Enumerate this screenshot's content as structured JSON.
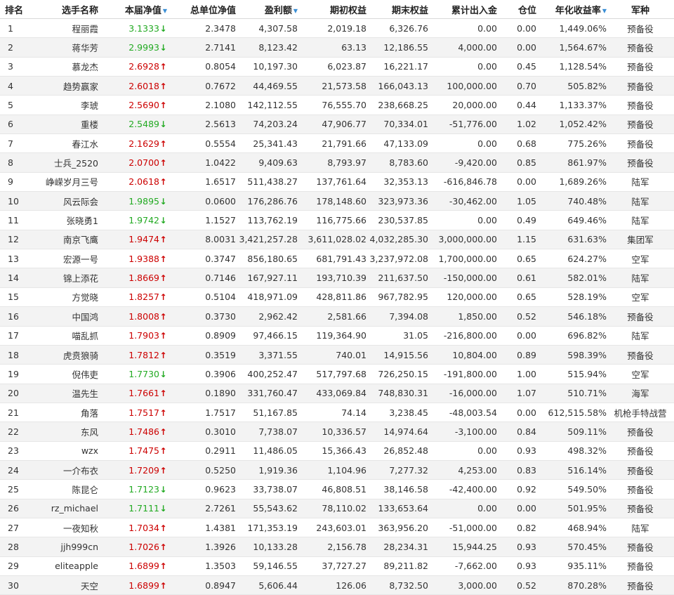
{
  "headers": {
    "rank": "排名",
    "name": "选手名称",
    "nav": "本届净值",
    "total_nav": "总单位净值",
    "profit": "盈利额",
    "start_equity": "期初权益",
    "end_equity": "期末权益",
    "net_deposit": "累计出入金",
    "position": "仓位",
    "annual_return": "年化收益率",
    "group": "军种"
  },
  "colors": {
    "up": "#cc0000",
    "down": "#22aa22",
    "sort_icon": "#3a8fd6",
    "zebra": "#f3f3f3"
  },
  "icons": {
    "sort": "sort-down-icon",
    "up": "arrow-up-icon",
    "down": "arrow-down-icon"
  },
  "rows": [
    {
      "rank": "1",
      "name": "程丽霞",
      "nav": "3.1333",
      "dir": "down",
      "total_nav": "2.3478",
      "profit": "4,307.58",
      "start": "2,019.18",
      "end": "6,326.76",
      "deposit": "0.00",
      "position": "0.00",
      "annual": "1,449.06%",
      "group": "预备役"
    },
    {
      "rank": "2",
      "name": "蒋华芳",
      "nav": "2.9993",
      "dir": "down",
      "total_nav": "2.7141",
      "profit": "8,123.42",
      "start": "63.13",
      "end": "12,186.55",
      "deposit": "4,000.00",
      "position": "0.00",
      "annual": "1,564.67%",
      "group": "预备役"
    },
    {
      "rank": "3",
      "name": "慕龙杰",
      "nav": "2.6928",
      "dir": "up",
      "total_nav": "0.8054",
      "profit": "10,197.30",
      "start": "6,023.87",
      "end": "16,221.17",
      "deposit": "0.00",
      "position": "0.45",
      "annual": "1,128.54%",
      "group": "预备役"
    },
    {
      "rank": "4",
      "name": "趋势赢家",
      "nav": "2.6018",
      "dir": "up",
      "total_nav": "0.7672",
      "profit": "44,469.55",
      "start": "21,573.58",
      "end": "166,043.13",
      "deposit": "100,000.00",
      "position": "0.70",
      "annual": "505.82%",
      "group": "预备役"
    },
    {
      "rank": "5",
      "name": "李琥",
      "nav": "2.5690",
      "dir": "up",
      "total_nav": "2.1080",
      "profit": "142,112.55",
      "start": "76,555.70",
      "end": "238,668.25",
      "deposit": "20,000.00",
      "position": "0.44",
      "annual": "1,133.37%",
      "group": "预备役"
    },
    {
      "rank": "6",
      "name": "重楼",
      "nav": "2.5489",
      "dir": "down",
      "total_nav": "2.5613",
      "profit": "74,203.24",
      "start": "47,906.77",
      "end": "70,334.01",
      "deposit": "-51,776.00",
      "position": "1.02",
      "annual": "1,052.42%",
      "group": "预备役"
    },
    {
      "rank": "7",
      "name": "春江水",
      "nav": "2.1629",
      "dir": "up",
      "total_nav": "0.5554",
      "profit": "25,341.43",
      "start": "21,791.66",
      "end": "47,133.09",
      "deposit": "0.00",
      "position": "0.68",
      "annual": "775.26%",
      "group": "预备役"
    },
    {
      "rank": "8",
      "name": "士兵_2520",
      "nav": "2.0700",
      "dir": "up",
      "total_nav": "1.0422",
      "profit": "9,409.63",
      "start": "8,793.97",
      "end": "8,783.60",
      "deposit": "-9,420.00",
      "position": "0.85",
      "annual": "861.97%",
      "group": "预备役"
    },
    {
      "rank": "9",
      "name": "峥嵘岁月三号",
      "nav": "2.0618",
      "dir": "up",
      "total_nav": "1.6517",
      "profit": "511,438.27",
      "start": "137,761.64",
      "end": "32,353.13",
      "deposit": "-616,846.78",
      "position": "0.00",
      "annual": "1,689.26%",
      "group": "陆军"
    },
    {
      "rank": "10",
      "name": "风云际会",
      "nav": "1.9895",
      "dir": "down",
      "total_nav": "0.0600",
      "profit": "176,286.76",
      "start": "178,148.60",
      "end": "323,973.36",
      "deposit": "-30,462.00",
      "position": "1.05",
      "annual": "740.48%",
      "group": "陆军"
    },
    {
      "rank": "11",
      "name": "张晓勇1",
      "nav": "1.9742",
      "dir": "down",
      "total_nav": "1.1527",
      "profit": "113,762.19",
      "start": "116,775.66",
      "end": "230,537.85",
      "deposit": "0.00",
      "position": "0.49",
      "annual": "649.46%",
      "group": "陆军"
    },
    {
      "rank": "12",
      "name": "南京飞鹰",
      "nav": "1.9474",
      "dir": "up",
      "total_nav": "8.0031",
      "profit": "3,421,257.28",
      "start": "3,611,028.02",
      "end": "4,032,285.30",
      "deposit": "3,000,000.00",
      "position": "1.15",
      "annual": "631.63%",
      "group": "集团军"
    },
    {
      "rank": "13",
      "name": "宏源一号",
      "nav": "1.9388",
      "dir": "up",
      "total_nav": "0.3747",
      "profit": "856,180.65",
      "start": "681,791.43",
      "end": "3,237,972.08",
      "deposit": "1,700,000.00",
      "position": "0.65",
      "annual": "624.27%",
      "group": "空军"
    },
    {
      "rank": "14",
      "name": "锦上添花",
      "nav": "1.8669",
      "dir": "up",
      "total_nav": "0.7146",
      "profit": "167,927.11",
      "start": "193,710.39",
      "end": "211,637.50",
      "deposit": "-150,000.00",
      "position": "0.61",
      "annual": "582.01%",
      "group": "陆军"
    },
    {
      "rank": "15",
      "name": "方觉晓",
      "nav": "1.8257",
      "dir": "up",
      "total_nav": "0.5104",
      "profit": "418,971.09",
      "start": "428,811.86",
      "end": "967,782.95",
      "deposit": "120,000.00",
      "position": "0.65",
      "annual": "528.19%",
      "group": "空军"
    },
    {
      "rank": "16",
      "name": "中国鸿",
      "nav": "1.8008",
      "dir": "up",
      "total_nav": "0.3730",
      "profit": "2,962.42",
      "start": "2,581.66",
      "end": "7,394.08",
      "deposit": "1,850.00",
      "position": "0.52",
      "annual": "546.18%",
      "group": "预备役"
    },
    {
      "rank": "17",
      "name": "喵乱抓",
      "nav": "1.7903",
      "dir": "up",
      "total_nav": "0.8909",
      "profit": "97,466.15",
      "start": "119,364.90",
      "end": "31.05",
      "deposit": "-216,800.00",
      "position": "0.00",
      "annual": "696.82%",
      "group": "陆军"
    },
    {
      "rank": "18",
      "name": "虎贲狼骑",
      "nav": "1.7812",
      "dir": "up",
      "total_nav": "0.3519",
      "profit": "3,371.55",
      "start": "740.01",
      "end": "14,915.56",
      "deposit": "10,804.00",
      "position": "0.89",
      "annual": "598.39%",
      "group": "预备役"
    },
    {
      "rank": "19",
      "name": "倪伟吏",
      "nav": "1.7730",
      "dir": "down",
      "total_nav": "0.3906",
      "profit": "400,252.47",
      "start": "517,797.68",
      "end": "726,250.15",
      "deposit": "-191,800.00",
      "position": "1.00",
      "annual": "515.94%",
      "group": "空军"
    },
    {
      "rank": "20",
      "name": "温先生",
      "nav": "1.7661",
      "dir": "up",
      "total_nav": "0.1890",
      "profit": "331,760.47",
      "start": "433,069.84",
      "end": "748,830.31",
      "deposit": "-16,000.00",
      "position": "1.07",
      "annual": "510.71%",
      "group": "海军"
    },
    {
      "rank": "21",
      "name": "角落",
      "nav": "1.7517",
      "dir": "up",
      "total_nav": "1.7517",
      "profit": "51,167.85",
      "start": "74.14",
      "end": "3,238.45",
      "deposit": "-48,003.54",
      "position": "0.00",
      "annual": "612,515.58%",
      "group": "机枪手特战营"
    },
    {
      "rank": "22",
      "name": "东风",
      "nav": "1.7486",
      "dir": "up",
      "total_nav": "0.3010",
      "profit": "7,738.07",
      "start": "10,336.57",
      "end": "14,974.64",
      "deposit": "-3,100.00",
      "position": "0.84",
      "annual": "509.11%",
      "group": "预备役"
    },
    {
      "rank": "23",
      "name": "wzx",
      "nav": "1.7475",
      "dir": "up",
      "total_nav": "0.2911",
      "profit": "11,486.05",
      "start": "15,366.43",
      "end": "26,852.48",
      "deposit": "0.00",
      "position": "0.93",
      "annual": "498.32%",
      "group": "预备役"
    },
    {
      "rank": "24",
      "name": "一介布衣",
      "nav": "1.7209",
      "dir": "up",
      "total_nav": "0.5250",
      "profit": "1,919.36",
      "start": "1,104.96",
      "end": "7,277.32",
      "deposit": "4,253.00",
      "position": "0.83",
      "annual": "516.14%",
      "group": "预备役"
    },
    {
      "rank": "25",
      "name": "陈昆仑",
      "nav": "1.7123",
      "dir": "down",
      "total_nav": "0.9623",
      "profit": "33,738.07",
      "start": "46,808.51",
      "end": "38,146.58",
      "deposit": "-42,400.00",
      "position": "0.92",
      "annual": "549.50%",
      "group": "预备役"
    },
    {
      "rank": "26",
      "name": "rz_michael",
      "nav": "1.7111",
      "dir": "down",
      "total_nav": "2.7261",
      "profit": "55,543.62",
      "start": "78,110.02",
      "end": "133,653.64",
      "deposit": "0.00",
      "position": "0.00",
      "annual": "501.95%",
      "group": "预备役"
    },
    {
      "rank": "27",
      "name": "一夜知秋",
      "nav": "1.7034",
      "dir": "up",
      "total_nav": "1.4381",
      "profit": "171,353.19",
      "start": "243,603.01",
      "end": "363,956.20",
      "deposit": "-51,000.00",
      "position": "0.82",
      "annual": "468.94%",
      "group": "陆军"
    },
    {
      "rank": "28",
      "name": "jjh999cn",
      "nav": "1.7026",
      "dir": "up",
      "total_nav": "1.3926",
      "profit": "10,133.28",
      "start": "2,156.78",
      "end": "28,234.31",
      "deposit": "15,944.25",
      "position": "0.93",
      "annual": "570.45%",
      "group": "预备役"
    },
    {
      "rank": "29",
      "name": "eliteapple",
      "nav": "1.6899",
      "dir": "up",
      "total_nav": "1.3503",
      "profit": "59,146.55",
      "start": "37,727.27",
      "end": "89,211.82",
      "deposit": "-7,662.00",
      "position": "0.93",
      "annual": "935.11%",
      "group": "预备役"
    },
    {
      "rank": "30",
      "name": "天空",
      "nav": "1.6899",
      "dir": "up",
      "total_nav": "0.8947",
      "profit": "5,606.44",
      "start": "126.06",
      "end": "8,732.50",
      "deposit": "3,000.00",
      "position": "0.52",
      "annual": "870.28%",
      "group": "预备役"
    }
  ]
}
